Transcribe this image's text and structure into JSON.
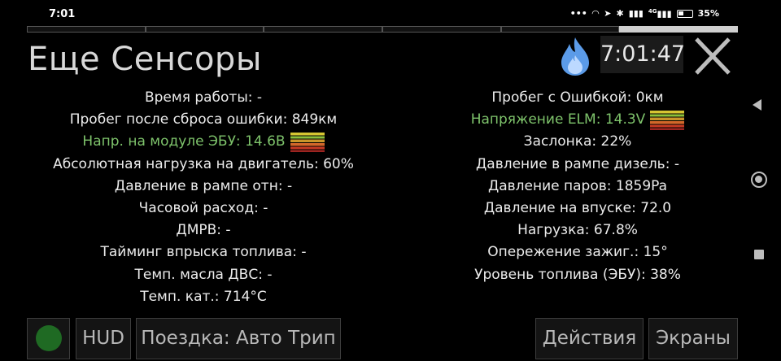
{
  "status_bar": {
    "time": "7:01",
    "icons": [
      "more-icon",
      "headphones-icon",
      "location-icon",
      "bluetooth-icon",
      "signal-icon",
      "4g-signal-icon",
      "battery-icon"
    ],
    "signal_label": "4G",
    "battery": "35%"
  },
  "header": {
    "title": "Еще Сенсоры",
    "clock": "7:01:47"
  },
  "progress": {
    "segments": 6,
    "active_segment": 6
  },
  "sensors_left": [
    {
      "text": "Время работы: -"
    },
    {
      "text": "Пробег после сброса ошибки: 849км"
    },
    {
      "text": "Напр. на модуле ЭБУ: 14.6В",
      "status": "ok"
    },
    {
      "text": "Абсолютная нагрузка на двигатель: 60%"
    },
    {
      "text": "Давление в рампе отн: -"
    },
    {
      "text": "Часовой расход: -"
    },
    {
      "text": "ДМРВ: -"
    },
    {
      "text": "Тайминг впрыска топлива: -"
    },
    {
      "text": "Темп. масла ДВС: -"
    },
    {
      "text": "Темп. кат.: 714°C"
    }
  ],
  "sensors_right": [
    {
      "text": "Пробег с Ошибкой: 0км"
    },
    {
      "text": "Напряжение ELM: 14.3V",
      "status": "ok"
    },
    {
      "text": "Заслонка: 22%"
    },
    {
      "text": "Давление в рампе дизель: -"
    },
    {
      "text": "Давление паров: 1859Pa"
    },
    {
      "text": "Давление на впуске: 72.0"
    },
    {
      "text": "Нагрузка: 67.8%"
    },
    {
      "text": "Опережение зажиг.: 15°"
    },
    {
      "text": "Уровень топлива (ЭБУ): 38%"
    }
  ],
  "buttons": {
    "hud": "HUD",
    "trip": "Поездка: Авто Трип",
    "actions": "Действия",
    "screens": "Экраны"
  },
  "colors": {
    "ok_text": "#7ec36b",
    "status_dot": "#1f6a23",
    "flame": "#5b9be8"
  }
}
